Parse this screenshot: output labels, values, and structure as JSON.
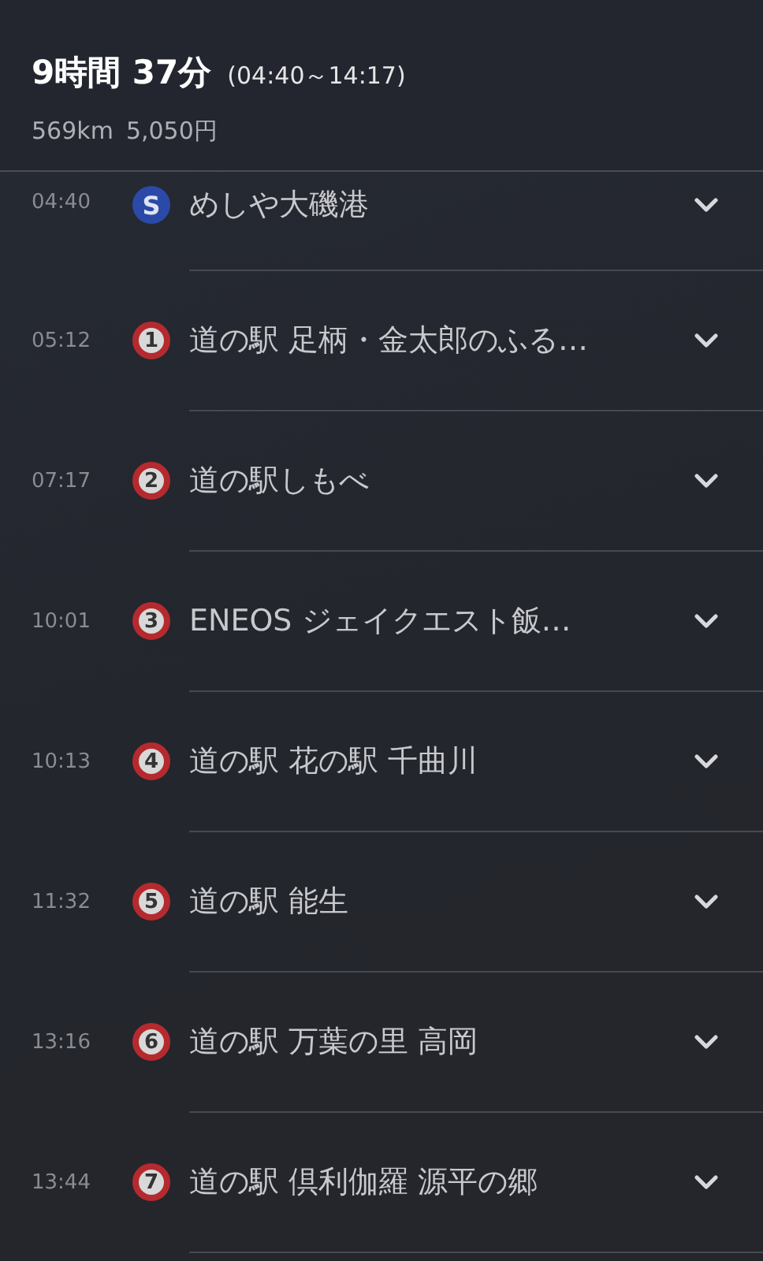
{
  "header": {
    "duration": "9時間 37分",
    "time_range": "(04:40～14:17)",
    "distance": "569km",
    "toll": "5,050円"
  },
  "stops": [
    {
      "kind": "start",
      "time": "04:40",
      "marker": "S",
      "name": "めしや大磯港"
    },
    {
      "kind": "stop",
      "time": "05:12",
      "marker": "1",
      "name": "道の駅 足柄・金太郎のふる…"
    },
    {
      "kind": "stop",
      "time": "07:17",
      "marker": "2",
      "name": "道の駅しもべ"
    },
    {
      "kind": "stop",
      "time": "10:01",
      "marker": "3",
      "name": "ENEOS ジェイクエスト飯…"
    },
    {
      "kind": "stop",
      "time": "10:13",
      "marker": "4",
      "name": "道の駅 花の駅 千曲川"
    },
    {
      "kind": "stop",
      "time": "11:32",
      "marker": "5",
      "name": "道の駅 能生"
    },
    {
      "kind": "stop",
      "time": "13:16",
      "marker": "6",
      "name": "道の駅 万葉の里 高岡"
    },
    {
      "kind": "stop",
      "time": "13:44",
      "marker": "7",
      "name": "道の駅 倶利伽羅 源平の郷"
    }
  ]
}
